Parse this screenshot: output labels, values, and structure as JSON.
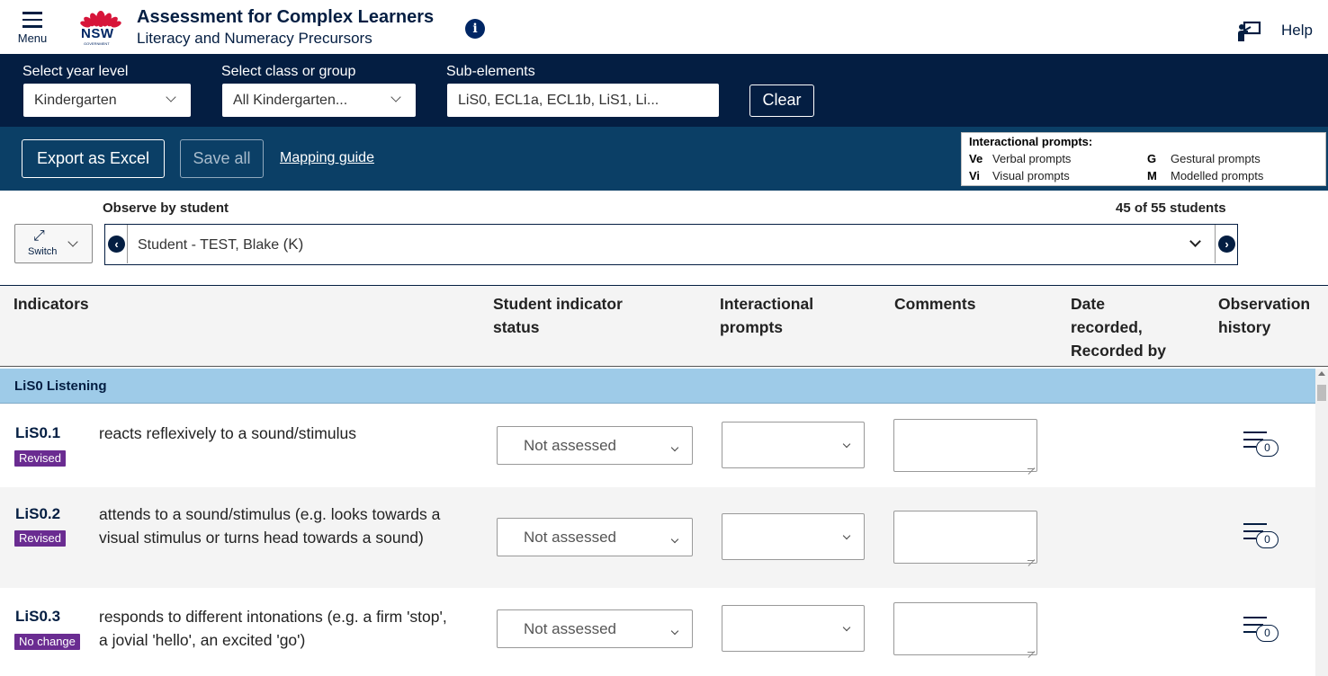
{
  "header": {
    "menu_label": "Menu",
    "logo_text": "NSW",
    "logo_subtext": "GOVERNMENT",
    "title": "Assessment for Complex Learners",
    "subtitle": "Literacy and Numeracy Precursors",
    "info_glyph": "i",
    "help_label": "Help"
  },
  "filters": {
    "year_label": "Select year level",
    "year_value": "Kindergarten",
    "class_label": "Select class or group",
    "class_value": "All Kindergarten...",
    "sub_label": "Sub-elements",
    "sub_value": "LiS0, ECL1a, ECL1b, LiS1, Li...",
    "clear_label": "Clear"
  },
  "actions": {
    "export_label": "Export as Excel",
    "saveall_label": "Save all",
    "mapping_label": "Mapping guide"
  },
  "legend": {
    "title": "Interactional prompts:",
    "items": [
      {
        "code": "Ve",
        "label": "Verbal prompts"
      },
      {
        "code": "Vi",
        "label": "Visual prompts"
      },
      {
        "code": "G",
        "label": "Gestural prompts"
      },
      {
        "code": "M",
        "label": "Modelled prompts"
      }
    ]
  },
  "observe": {
    "label": "Observe by student",
    "count": "45 of 55 students",
    "switch_label": "Switch",
    "student_name": "Student - TEST, Blake",
    "student_year": "(K)"
  },
  "table": {
    "headers": {
      "indicators": "Indicators",
      "status_line1": "Student indicator",
      "status_line2": "status",
      "prompts_line1": "Interactional",
      "prompts_line2": "prompts",
      "comments": "Comments",
      "date_line1": "Date",
      "date_line2": "recorded,",
      "date_line3": "Recorded by",
      "history_line1": "Observation",
      "history_line2": "history"
    },
    "section_title": "LiS0 Listening",
    "rows": [
      {
        "code": "LiS0.1",
        "badge": "Revised",
        "description": "reacts reflexively to a sound/stimulus",
        "status": "Not assessed",
        "history_count": "0"
      },
      {
        "code": "LiS0.2",
        "badge": "Revised",
        "description": "attends to a sound/stimulus (e.g. looks towards a visual stimulus or turns head towards a sound)",
        "status": "Not assessed",
        "history_count": "0"
      },
      {
        "code": "LiS0.3",
        "badge": "No change",
        "description": "responds to different intonations (e.g. a firm 'stop', a jovial 'hello', an excited 'go')",
        "status": "Not assessed",
        "history_count": "0"
      }
    ]
  },
  "colors": {
    "navy": "#041e42",
    "action_bar": "#0b3f66",
    "section_bg": "#9ecbe8",
    "badge": "#6a2c91",
    "nsw_red": "#d7153a"
  },
  "icons": [
    "menu-icon",
    "nsw-waratah-logo",
    "info-icon",
    "help-icon",
    "chevron-down-icon",
    "switch-arrows-icon",
    "chevron-left-icon",
    "chevron-right-icon",
    "history-list-icon"
  ]
}
